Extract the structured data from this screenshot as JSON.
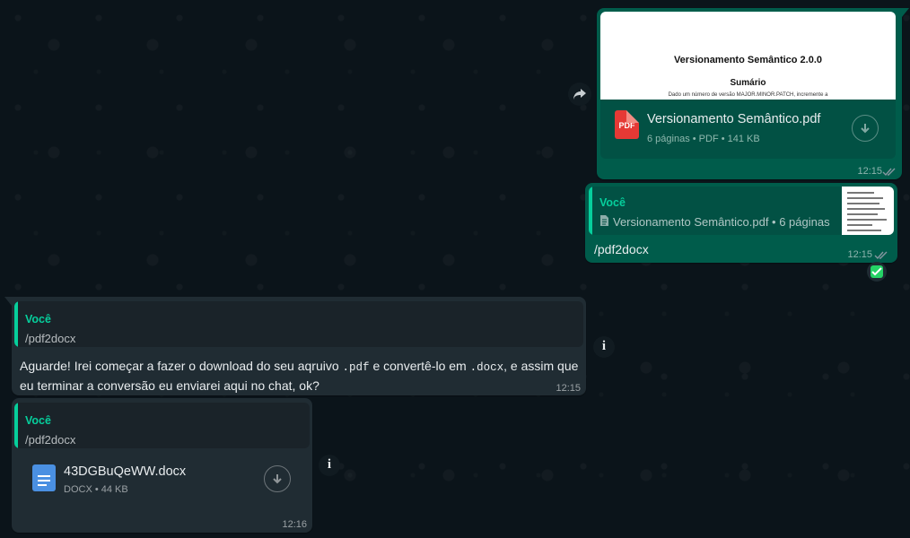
{
  "messages": [
    {
      "direction": "outgoing",
      "preview": {
        "title": "Versionamento Semântico 2.0.0",
        "subtitle": "Sumário",
        "first_line": "Dado um número de versão MAJOR.MINOR.PATCH, incremente a"
      },
      "file": {
        "icon_label": "PDF",
        "name": "Versionamento Semântico.pdf",
        "meta": "6 páginas • PDF • 141 KB"
      },
      "time": "12:15",
      "status": "read"
    },
    {
      "direction": "outgoing",
      "quote": {
        "author": "Você",
        "text": "Versionamento Semântico.pdf • 6 páginas"
      },
      "text": "/pdf2docx",
      "time": "12:15",
      "status": "read"
    },
    {
      "direction": "incoming",
      "quote": {
        "author": "Você",
        "text": "/pdf2docx"
      },
      "text_parts": {
        "p1": "Aguarde! Irei começar a fazer o download do seu aqruivo ",
        "code1": ".pdf",
        "p2": " e convertê-lo em ",
        "code2": ".docx",
        "p3": ", e assim que",
        "line2": "eu terminar a conversão eu enviarei aqui no chat, ok?"
      },
      "time": "12:15"
    },
    {
      "direction": "incoming",
      "quote": {
        "author": "Você",
        "text": "/pdf2docx"
      },
      "file": {
        "name": "43DGBuQeWW.docx",
        "meta": "DOCX • 44 KB"
      },
      "time": "12:16"
    }
  ],
  "icons": {
    "forward": "forward-icon",
    "download": "download-icon",
    "info": "info-icon",
    "check": "check-icon"
  },
  "colors": {
    "background": "#0b141a",
    "outgoing_bubble": "#005c4b",
    "incoming_bubble": "#202c33",
    "accent": "#06cf9c",
    "pdf_red": "#e53935",
    "docx_blue": "#4a90e2"
  }
}
